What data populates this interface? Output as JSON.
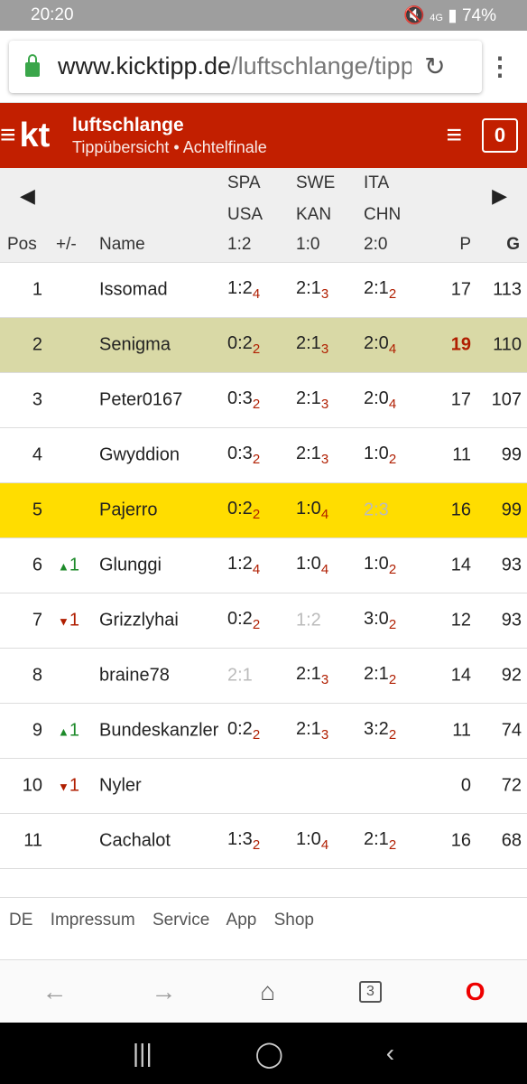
{
  "status": {
    "time": "20:20",
    "battery": "74%",
    "network": "4G"
  },
  "browser": {
    "host": "www.kicktipp.de",
    "path": "/luftschlange/tippuebersicht",
    "tabs": "3"
  },
  "header": {
    "group": "luftschlange",
    "subtitle": "Tippübersicht • Achtelfinale",
    "badge": "0"
  },
  "columns": {
    "pos": "Pos",
    "change": "+/-",
    "name": "Name",
    "p": "P",
    "g": "G",
    "matches": [
      {
        "home": "SPA",
        "away": "USA",
        "result": "1:2"
      },
      {
        "home": "SWE",
        "away": "KAN",
        "result": "1:0"
      },
      {
        "home": "ITA",
        "away": "CHN",
        "result": "2:0"
      }
    ]
  },
  "rows": [
    {
      "pos": "1",
      "change": "",
      "dir": "",
      "name": "Issomad",
      "tips": [
        [
          "1:2",
          "4"
        ],
        [
          "2:1",
          "3"
        ],
        [
          "2:1",
          "2"
        ]
      ],
      "p": "17",
      "g": "113"
    },
    {
      "pos": "2",
      "change": "",
      "dir": "",
      "name": "Senigma",
      "tips": [
        [
          "0:2",
          "2"
        ],
        [
          "2:1",
          "3"
        ],
        [
          "2:0",
          "4"
        ]
      ],
      "p": "19",
      "g": "110",
      "hl": "leader"
    },
    {
      "pos": "3",
      "change": "",
      "dir": "",
      "name": "Peter0167",
      "tips": [
        [
          "0:3",
          "2"
        ],
        [
          "2:1",
          "3"
        ],
        [
          "2:0",
          "4"
        ]
      ],
      "p": "17",
      "g": "107"
    },
    {
      "pos": "4",
      "change": "",
      "dir": "",
      "name": "Gwyddion",
      "tips": [
        [
          "0:3",
          "2"
        ],
        [
          "2:1",
          "3"
        ],
        [
          "1:0",
          "2"
        ]
      ],
      "p": "11",
      "g": "99"
    },
    {
      "pos": "5",
      "change": "",
      "dir": "",
      "name": "Pajerro",
      "tips": [
        [
          "0:2",
          "2"
        ],
        [
          "1:0",
          "4"
        ],
        [
          "2:3",
          ""
        ]
      ],
      "p": "16",
      "g": "99",
      "hl": "self"
    },
    {
      "pos": "6",
      "change": "1",
      "dir": "up",
      "name": "Glunggi",
      "tips": [
        [
          "1:2",
          "4"
        ],
        [
          "1:0",
          "4"
        ],
        [
          "1:0",
          "2"
        ]
      ],
      "p": "14",
      "g": "93"
    },
    {
      "pos": "7",
      "change": "1",
      "dir": "down",
      "name": "Grizzlyhai",
      "tips": [
        [
          "0:2",
          "2"
        ],
        [
          "1:2",
          ""
        ],
        [
          "3:0",
          "2"
        ]
      ],
      "p": "12",
      "g": "93"
    },
    {
      "pos": "8",
      "change": "",
      "dir": "",
      "name": "braine78",
      "tips": [
        [
          "2:1",
          ""
        ],
        [
          "2:1",
          "3"
        ],
        [
          "2:1",
          "2"
        ]
      ],
      "p": "14",
      "g": "92"
    },
    {
      "pos": "9",
      "change": "1",
      "dir": "up",
      "name": "Bundeskanzler",
      "tips": [
        [
          "0:2",
          "2"
        ],
        [
          "2:1",
          "3"
        ],
        [
          "3:2",
          "2"
        ]
      ],
      "p": "11",
      "g": "74"
    },
    {
      "pos": "10",
      "change": "1",
      "dir": "down",
      "name": "Nyler",
      "tips": [
        [
          "",
          ""
        ],
        [
          "",
          ""
        ],
        [
          "",
          ""
        ]
      ],
      "p": "0",
      "g": "72"
    },
    {
      "pos": "11",
      "change": "",
      "dir": "",
      "name": "Cachalot",
      "tips": [
        [
          "1:3",
          "2"
        ],
        [
          "1:0",
          "4"
        ],
        [
          "2:1",
          "2"
        ]
      ],
      "p": "16",
      "g": "68"
    }
  ],
  "footer": [
    "DE",
    "Impressum",
    "Service",
    "App",
    "Shop"
  ],
  "colors": {
    "brand": "#c21f00",
    "leader_row": "#d9d9a6",
    "self_row": "#ffdd00",
    "points": "#b01e00"
  }
}
